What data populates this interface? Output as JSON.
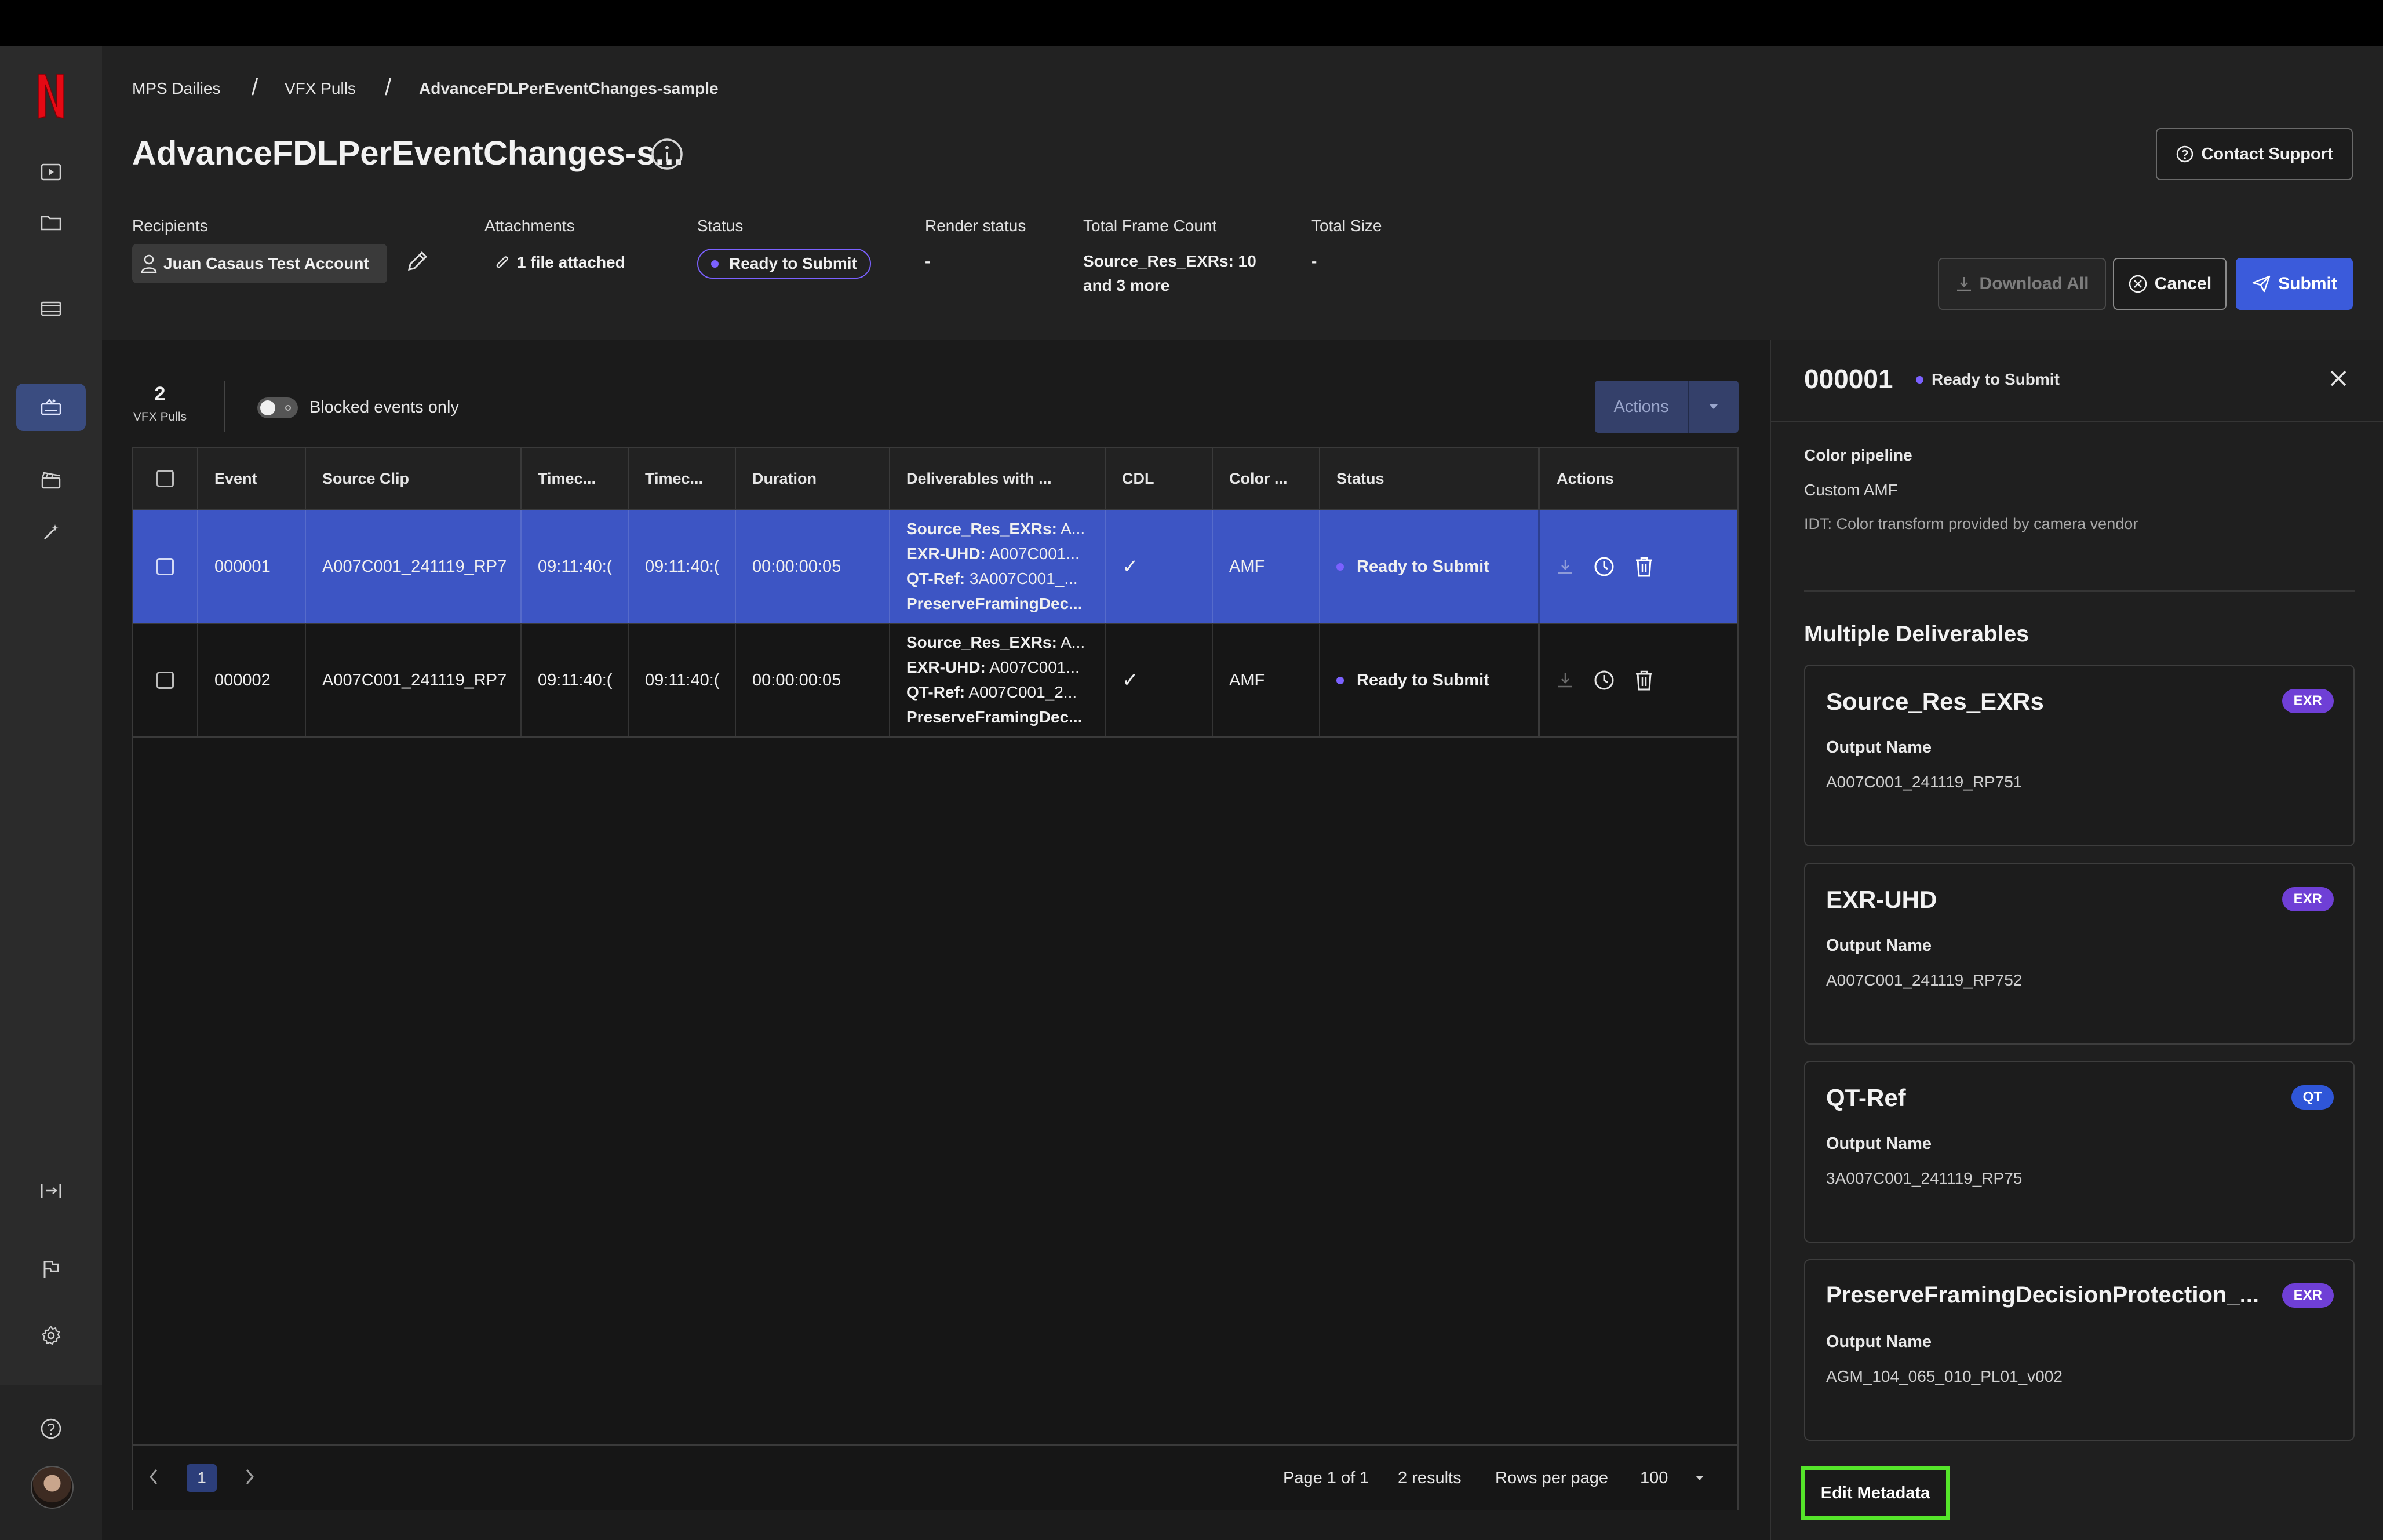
{
  "colors": {
    "accent": "#3b5bdb",
    "selected_row": "#3d55c4",
    "status_dot": "#7b61ff",
    "exr_badge": "#6f3fd6",
    "qt_badge": "#2f56d8",
    "highlight": "#55e52a",
    "netflix_red": "#e50914"
  },
  "sidebar": {
    "logo": "N",
    "items": [
      {
        "icon": "play-square-icon"
      },
      {
        "icon": "folder-icon"
      },
      {
        "icon": "film-strip-icon"
      },
      {
        "icon": "vfx-pulls-icon",
        "active": true
      },
      {
        "icon": "clapperboard-icon"
      },
      {
        "icon": "magic-wand-icon"
      }
    ],
    "bottom": [
      {
        "icon": "expand-panel-icon"
      },
      {
        "icon": "flag-icon"
      },
      {
        "icon": "gear-icon"
      },
      {
        "icon": "help-icon"
      },
      {
        "icon": "avatar"
      }
    ]
  },
  "header": {
    "breadcrumbs": [
      "MPS Dailies",
      "VFX Pulls",
      "AdvanceFDLPerEventChanges-sample"
    ],
    "separator": "/",
    "title": "AdvanceFDLPerEventChanges-s...",
    "contact_support": "Contact Support",
    "meta": {
      "recipients_label": "Recipients",
      "recipient": "Juan Casaus Test Account",
      "attachments_label": "Attachments",
      "attachments": "1 file attached",
      "status_label": "Status",
      "status": "Ready to Submit",
      "render_status_label": "Render status",
      "render_status": "-",
      "frame_count_label": "Total Frame Count",
      "frame_count_line1": "Source_Res_EXRs: 10",
      "frame_count_line2": "and 3 more",
      "total_size_label": "Total Size",
      "total_size": "-"
    },
    "buttons": {
      "download_all": "Download All",
      "cancel": "Cancel",
      "submit": "Submit"
    }
  },
  "toolbar": {
    "count": "2",
    "count_label": "VFX Pulls",
    "toggle_label": "Blocked events only",
    "actions": "Actions"
  },
  "table": {
    "columns": [
      "Event",
      "Source Clip",
      "Timec...",
      "Timec...",
      "Duration",
      "Deliverables with ...",
      "CDL",
      "Color ...",
      "Status",
      "Actions"
    ],
    "rows": [
      {
        "event": "000001",
        "source_clip": "A007C001_241119_RP7",
        "tc_in": "09:11:40:(",
        "tc_out": "09:11:40:(",
        "duration": "00:00:00:05",
        "deliverables": [
          {
            "name": "Source_Res_EXRs:",
            "value": " A..."
          },
          {
            "name": "EXR-UHD:",
            "value": " A007C001..."
          },
          {
            "name": "QT-Ref:",
            "value": " 3A007C001_..."
          },
          {
            "name": "PreserveFramingDec...",
            "value": ""
          }
        ],
        "cdl": "✓",
        "color": "AMF",
        "status": "Ready to Submit"
      },
      {
        "event": "000002",
        "source_clip": "A007C001_241119_RP7",
        "tc_in": "09:11:40:(",
        "tc_out": "09:11:40:(",
        "duration": "00:00:00:05",
        "deliverables": [
          {
            "name": "Source_Res_EXRs:",
            "value": " A..."
          },
          {
            "name": "EXR-UHD:",
            "value": " A007C001..."
          },
          {
            "name": "QT-Ref:",
            "value": " A007C001_2..."
          },
          {
            "name": "PreserveFramingDec...",
            "value": ""
          }
        ],
        "cdl": "✓",
        "color": "AMF",
        "status": "Ready to Submit"
      }
    ]
  },
  "pagination": {
    "current_page": "1",
    "page_info": "Page 1 of 1",
    "results": "2 results",
    "rows_per_page_label": "Rows per page",
    "rows_per_page": "100"
  },
  "panel": {
    "event": "000001",
    "status": "Ready to Submit",
    "color_pipeline_label": "Color pipeline",
    "color_pipeline": "Custom AMF",
    "idt": "IDT: Color transform provided by camera vendor",
    "deliverables_heading": "Multiple Deliverables",
    "deliverables": [
      {
        "title": "Source_Res_EXRs",
        "badge": "EXR",
        "label": "Output Name",
        "value": "A007C001_241119_RP751"
      },
      {
        "title": "EXR-UHD",
        "badge": "EXR",
        "label": "Output Name",
        "value": "A007C001_241119_RP752"
      },
      {
        "title": "QT-Ref",
        "badge": "QT",
        "label": "Output Name",
        "value": "3A007C001_241119_RP75"
      },
      {
        "title": "PreserveFramingDecisionProtection_...",
        "badge": "EXR",
        "label": "Output Name",
        "value": "AGM_104_065_010_PL01_v002"
      }
    ],
    "edit_metadata": "Edit Metadata"
  }
}
